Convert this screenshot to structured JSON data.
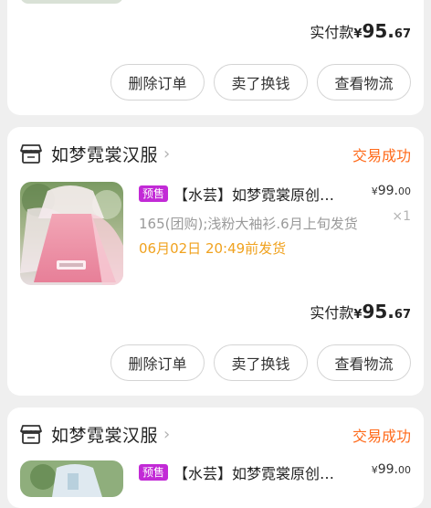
{
  "orders": [
    {
      "pay_label": "实付款",
      "pay_currency": "¥",
      "pay_amount": "95.",
      "pay_decimal": "67",
      "buttons": [
        "删除订单",
        "卖了换钱",
        "查看物流"
      ]
    },
    {
      "store": "如梦霓裳汉服",
      "status": "交易成功",
      "badge": "预售",
      "title": "【水芸】如梦霓裳原创…",
      "price_currency": "¥",
      "price_int": "99.",
      "price_dec": "00",
      "qty": "×1",
      "spec": "165(团购);浅粉大袖衫.6月上旬发货",
      "ship": "06月02日 20:49前发货",
      "pay_label": "实付款",
      "pay_currency": "¥",
      "pay_amount": "95.",
      "pay_decimal": "67",
      "buttons": [
        "删除订单",
        "卖了换钱",
        "查看物流"
      ]
    },
    {
      "store": "如梦霓裳汉服",
      "status": "交易成功",
      "badge": "预售",
      "title": "【水芸】如梦霓裳原创…",
      "price_currency": "¥",
      "price_int": "99.",
      "price_dec": "00"
    }
  ],
  "colors": {
    "status": "#ff6a1a",
    "ship": "#f0a21f",
    "badge": "#c22ad6"
  },
  "icons": {
    "store": "store-icon",
    "chevron": "chevron-right-icon"
  }
}
